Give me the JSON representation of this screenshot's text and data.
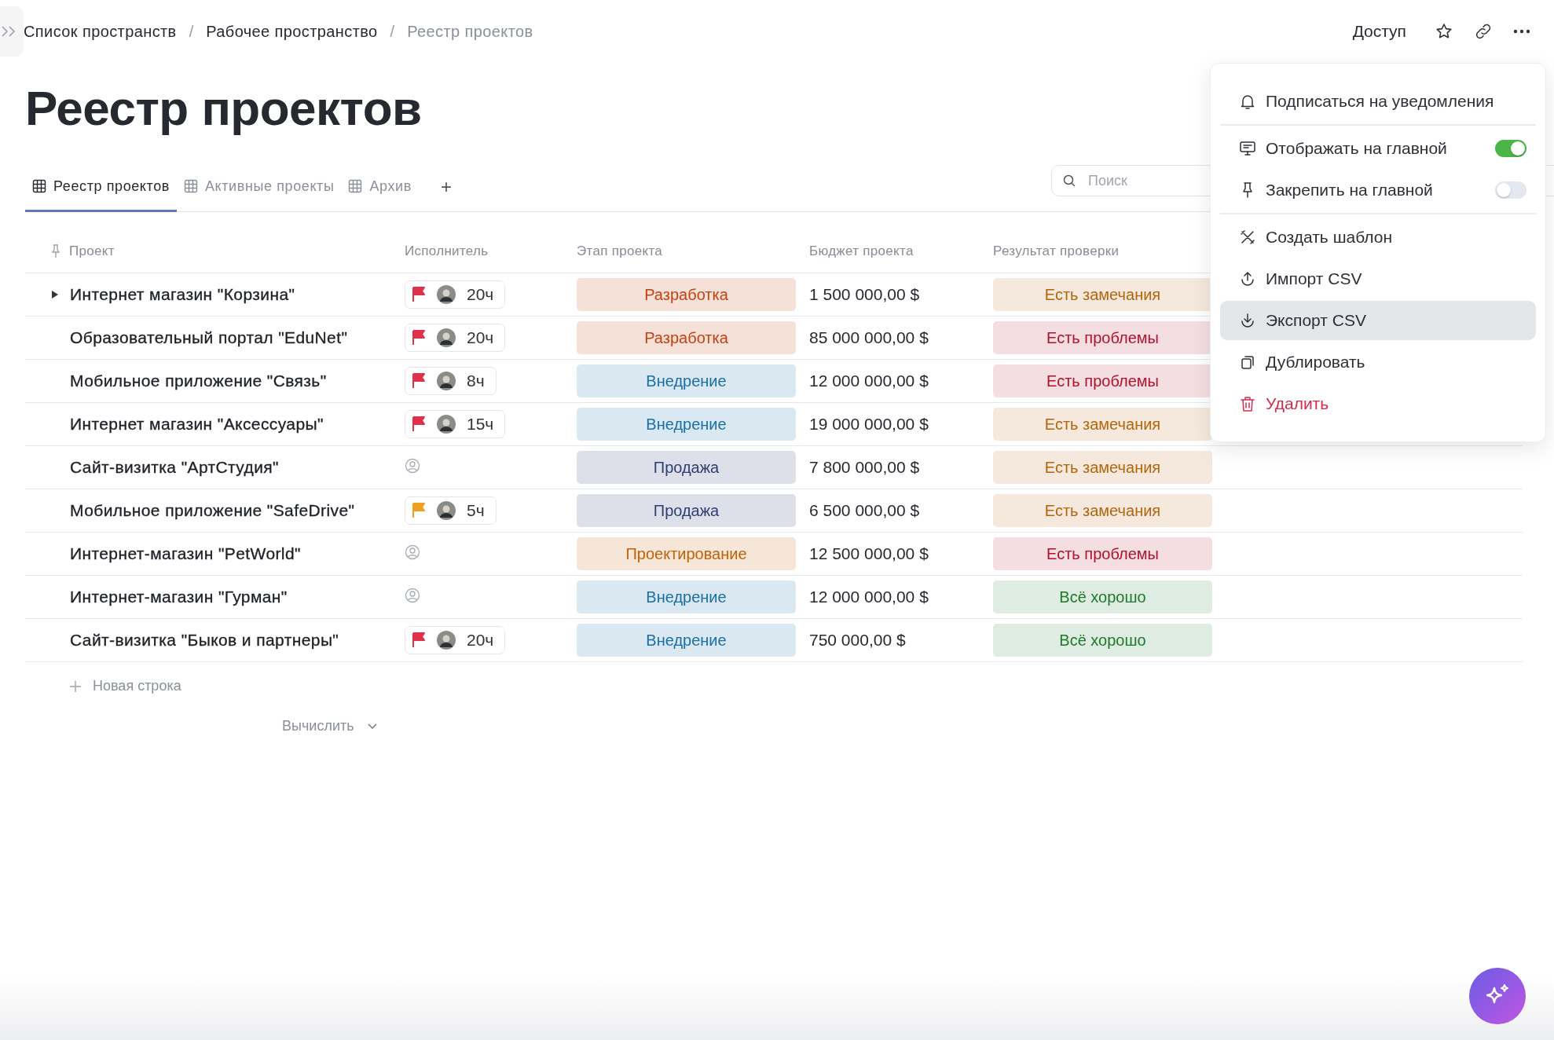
{
  "breadcrumbs": [
    "Список пространств",
    "Рабочее пространство",
    "Реестр проектов"
  ],
  "breadcrumb_separators": [
    "/",
    "/"
  ],
  "header_actions": {
    "access": "Доступ"
  },
  "title": "Реестр проектов",
  "tabs": [
    {
      "label": "Реестр проектов",
      "selected": true
    },
    {
      "label": "Активные проекты",
      "selected": false
    },
    {
      "label": "Архив",
      "selected": false
    }
  ],
  "add_tab": "+",
  "search": {
    "placeholder": "Поиск"
  },
  "table": {
    "columns": [
      "Проект",
      "Исполнитель",
      "Этап проекта",
      "Бюджет проекта",
      "Результат проверки"
    ],
    "rows": [
      {
        "name": "Интернет магазин \"Корзина\"",
        "expandable": true,
        "assignee": {
          "kind": "assigned",
          "color": "#e0314b",
          "hours": "20ч"
        },
        "stage": {
          "label": "Разработка",
          "color": "#c4420f"
        },
        "budget": "1 500 000,00 $",
        "result": {
          "label": "Есть замечания",
          "color": "#b5650c"
        }
      },
      {
        "name": "Образовательный портал \"EduNet\"",
        "expandable": false,
        "assignee": {
          "kind": "assigned",
          "color": "#e0314b",
          "hours": "20ч"
        },
        "stage": {
          "label": "Разработка",
          "color": "#c4420f"
        },
        "budget": "85 000 000,00 $",
        "result": {
          "label": "Есть проблемы",
          "color": "#b0122c"
        }
      },
      {
        "name": "Мобильное приложение \"Связь\"",
        "expandable": false,
        "assignee": {
          "kind": "assigned",
          "color": "#e0314b",
          "hours": "8ч"
        },
        "stage": {
          "label": "Внедрение",
          "color": "#1a6fa8"
        },
        "budget": "12 000 000,00 $",
        "result": {
          "label": "Есть проблемы",
          "color": "#b0122c"
        }
      },
      {
        "name": "Интернет магазин \"Аксессуары\"",
        "expandable": false,
        "assignee": {
          "kind": "assigned",
          "color": "#e0314b",
          "hours": "15ч"
        },
        "stage": {
          "label": "Внедрение",
          "color": "#1a6fa8"
        },
        "budget": "19 000 000,00 $",
        "result": {
          "label": "Есть замечания",
          "color": "#b5650c"
        }
      },
      {
        "name": "Сайт-визитка \"АртСтудия\"",
        "expandable": false,
        "assignee": {
          "kind": "none"
        },
        "stage": {
          "label": "Продажа",
          "color": "#2d3f73"
        },
        "budget": "7 800 000,00 $",
        "result": {
          "label": "Есть замечания",
          "color": "#b5650c"
        }
      },
      {
        "name": "Мобильное приложение \"SafeDrive\"",
        "expandable": false,
        "assignee": {
          "kind": "assigned",
          "color": "#f0a020",
          "hours": "5ч"
        },
        "stage": {
          "label": "Продажа",
          "color": "#2d3f73"
        },
        "budget": "6 500 000,00 $",
        "result": {
          "label": "Есть замечания",
          "color": "#b5650c"
        }
      },
      {
        "name": "Интернет-магазин \"PetWorld\"",
        "expandable": false,
        "assignee": {
          "kind": "none"
        },
        "stage": {
          "label": "Проектирование",
          "color": "#c0620a"
        },
        "budget": "12 500 000,00 $",
        "result": {
          "label": "Есть проблемы",
          "color": "#b0122c"
        }
      },
      {
        "name": "Интернет-магазин \"Гурман\"",
        "expandable": false,
        "assignee": {
          "kind": "none"
        },
        "stage": {
          "label": "Внедрение",
          "color": "#1a6fa8"
        },
        "budget": "12 000 000,00 $",
        "result": {
          "label": "Всё хорошо",
          "color": "#1c7a2a"
        }
      },
      {
        "name": "Сайт-визитка \"Быков и партнеры\"",
        "expandable": false,
        "assignee": {
          "kind": "assigned",
          "color": "#e0314b",
          "hours": "20ч"
        },
        "stage": {
          "label": "Внедрение",
          "color": "#1a6fa8"
        },
        "budget": "750 000,00 $",
        "result": {
          "label": "Всё хорошо",
          "color": "#1c7a2a"
        }
      }
    ],
    "add_row": "Новая строка",
    "calculate": "Вычислить"
  },
  "menu": {
    "sections": [
      [
        {
          "kind": "action",
          "label": "Подписаться на уведомления",
          "selected": false
        }
      ],
      [
        {
          "kind": "toggle",
          "label": "Отображать на главной",
          "on": true,
          "selected": false
        },
        {
          "kind": "toggle",
          "label": "Закрепить на главной",
          "on": false,
          "selected": false
        }
      ],
      [
        {
          "kind": "action",
          "label": "Создать шаблон",
          "selected": false
        },
        {
          "kind": "action",
          "label": "Импорт CSV",
          "selected": false
        },
        {
          "kind": "action",
          "label": "Экспорт CSV",
          "selected": true
        },
        {
          "kind": "action",
          "label": "Дублировать",
          "selected": false
        },
        {
          "kind": "danger",
          "label": "Удалить",
          "selected": false
        }
      ]
    ]
  }
}
